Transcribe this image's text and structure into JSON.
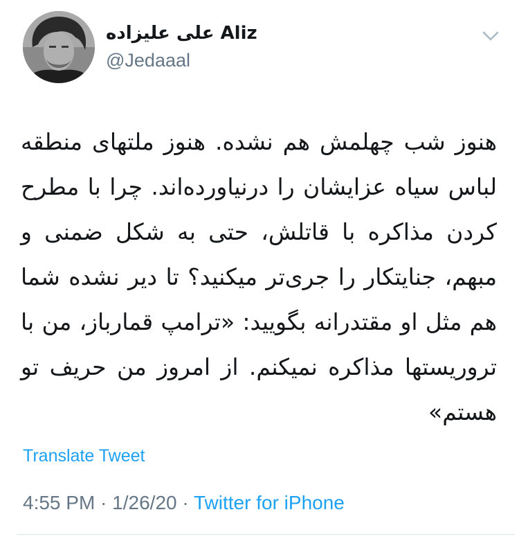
{
  "user": {
    "display_name": "علی علیزاده Aliz",
    "handle": "@Jedaaal"
  },
  "tweet": {
    "text": "هنوز شب چهلمش هم نشده. هنوز ملتهای منطقه لباس سیاه عزایشان را درنیاورده‌اند. چرا با مطرح کردن مذاکره با قاتلش، حتی به شکل ضمنی و مبهم، جنایتکار را جری‌تر میکنید؟ تا دیر نشده شما هم مثل او مقتدرانه بگویید: «ترامپ قمارباز، من با تروریستها مذاکره نمیکنم. از امروز من حریف تو هستم»",
    "translate_label": "Translate Tweet",
    "time": "4:55 PM",
    "date": "1/26/20",
    "separator": " · ",
    "source": "Twitter for iPhone"
  },
  "icons": {
    "menu": "chevron-down-icon",
    "avatar": "user-avatar"
  },
  "colors": {
    "accent": "#1da1f2",
    "secondary_text": "#657786",
    "primary_text": "#14171a",
    "divider": "#e1e8ed"
  }
}
